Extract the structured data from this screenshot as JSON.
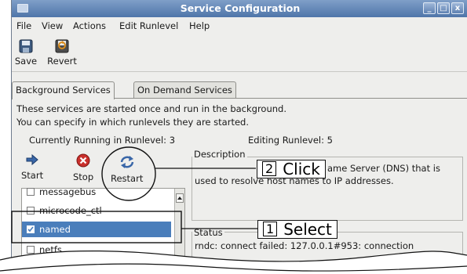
{
  "window": {
    "title": "Service Configuration",
    "controls": [
      "_",
      "□",
      "x"
    ]
  },
  "menu": {
    "file": "File",
    "view": "View",
    "actions": "Actions",
    "edit_runlevel": "Edit Runlevel",
    "help": "Help"
  },
  "toolbar": {
    "save": "Save",
    "revert": "Revert"
  },
  "tabs": {
    "background": "Background Services",
    "on_demand": "On Demand Services"
  },
  "info": {
    "line1": "These services are started once and run in the background.",
    "line2": "You can specify in which runlevels they are started.",
    "current": "Currently Running in Runlevel: 3",
    "editing": "Editing Runlevel: 5"
  },
  "services_toolbar": {
    "start": "Start",
    "stop": "Stop",
    "restart": "Restart"
  },
  "services": [
    {
      "name": "messagebus",
      "checked": false
    },
    {
      "name": "microcode_ctl",
      "checked": false
    },
    {
      "name": "named",
      "checked": true,
      "selected": true
    },
    {
      "name": "netfs",
      "checked": false
    }
  ],
  "description": {
    "label": "Description",
    "line1_visible": "ame Server (DNS) that is",
    "line2": "used to resolve host names to IP addresses."
  },
  "status": {
    "label": "Status",
    "text": "rndc: connect failed: 127.0.0.1#953: connection"
  },
  "callouts": {
    "click": {
      "number": "2",
      "text": "Click"
    },
    "select": {
      "number": "1",
      "text": "Select"
    }
  },
  "colors": {
    "titlebar_top": "#7f9fc8",
    "titlebar_bottom": "#4f75a9",
    "selection": "#4a7ebb",
    "window_bg": "#eeeeec"
  }
}
